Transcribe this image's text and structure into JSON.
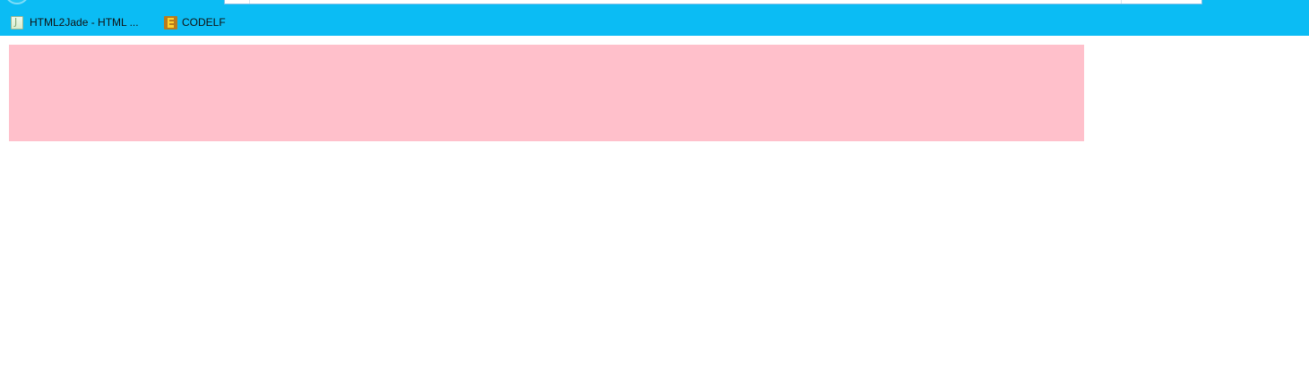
{
  "bookmarks": [
    {
      "label": "HTML2Jade - HTML ...",
      "icon": "html2jade-favicon-icon"
    },
    {
      "label": "CODELF",
      "icon": "codelf-favicon-icon"
    }
  ],
  "colors": {
    "chrome_background": "#0bbcf4",
    "page_background": "#ffffff",
    "box_background": "#ffc0cb"
  }
}
